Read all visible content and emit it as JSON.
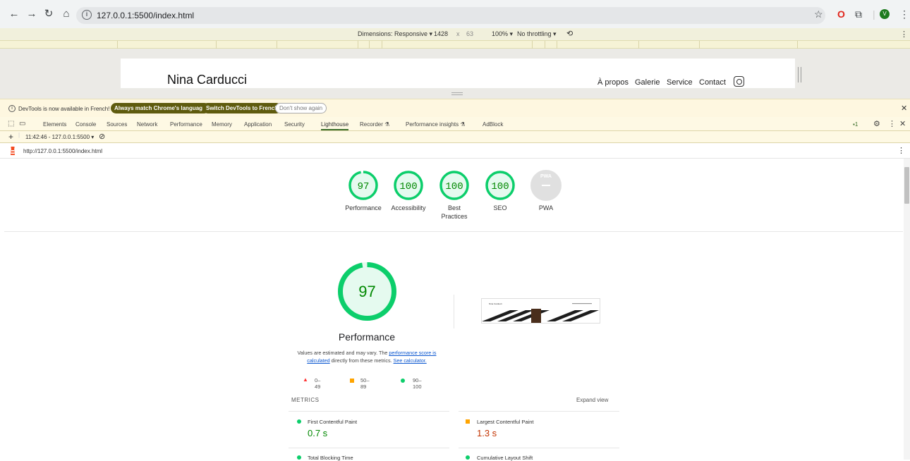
{
  "browser": {
    "url": "127.0.0.1:5500/index.html",
    "profile_initial": "V"
  },
  "device_toolbar": {
    "dimensions": "Dimensions: Responsive ▾",
    "width": "1428",
    "times": "x",
    "height": "63",
    "zoom": "100% ▾",
    "throttling": "No throttling ▾"
  },
  "site": {
    "brand": "Nina Carducci",
    "nav": [
      "À propos",
      "Galerie",
      "Service",
      "Contact"
    ]
  },
  "infobar": {
    "message": "DevTools is now available in French!",
    "btn_match": "Always match Chrome's language",
    "btn_switch": "Switch DevTools to French",
    "btn_dismiss": "Don't show again"
  },
  "devtools": {
    "tabs": [
      "Elements",
      "Console",
      "Sources",
      "Network",
      "Performance",
      "Memory",
      "Application",
      "Security",
      "Lighthouse",
      "Recorder ⚗",
      "Performance insights ⚗",
      "AdBlock"
    ],
    "active_tab": "Lighthouse",
    "issues_count": "1",
    "report_select": "11:42:46 - 127.0.0.1:5500 ▾",
    "report_url": "http://127.0.0.1:5500/index.html"
  },
  "scores": [
    {
      "label": "Performance",
      "value": "97",
      "pct": 97
    },
    {
      "label": "Accessibility",
      "value": "100",
      "pct": 100
    },
    {
      "label": "Best\nPractices",
      "value": "100",
      "pct": 100
    },
    {
      "label": "SEO",
      "value": "100",
      "pct": 100
    }
  ],
  "pwa": {
    "badge": "PWA",
    "label": "PWA"
  },
  "performance": {
    "score": "97",
    "score_pct": 97,
    "title": "Performance",
    "desc_prefix": "Values are estimated and may vary. The ",
    "desc_link1": "performance score is calculated",
    "desc_mid": " directly from these metrics. ",
    "desc_link2": "See calculator."
  },
  "legend": {
    "red": "0–49",
    "orange": "50–89",
    "green": "90–100"
  },
  "metrics": {
    "header": "METRICS",
    "expand": "Expand view",
    "items": [
      {
        "name": "First Contentful Paint",
        "value": "0.7 s",
        "status": "pass"
      },
      {
        "name": "Largest Contentful Paint",
        "value": "1.3 s",
        "status": "average"
      },
      {
        "name": "Total Blocking Time",
        "value": "",
        "status": "pass"
      },
      {
        "name": "Cumulative Layout Shift",
        "value": "",
        "status": "pass"
      }
    ]
  },
  "colors": {
    "pass": "#0cce6b",
    "pass_text": "#008800",
    "average": "#ffa400",
    "average_text": "#c33300",
    "fail": "#ff3333",
    "gauge_fill": "#e5faef"
  }
}
